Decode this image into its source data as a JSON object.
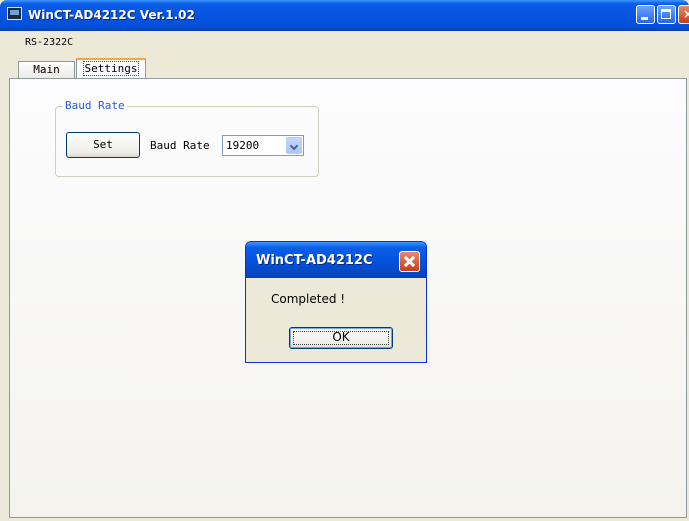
{
  "window": {
    "title": "WinCT-AD4212C Ver.1.02",
    "icon": "app-window-icon",
    "controls": [
      "minimize-icon",
      "maximize-icon",
      "close-icon"
    ]
  },
  "menubar": {
    "item": "RS-2322C"
  },
  "tabs": {
    "main": "Main",
    "settings": "Settings",
    "active": "Settings"
  },
  "baud_group": {
    "title": "Baud Rate",
    "set_button": "Set",
    "label": "Baud Rate",
    "selected_value": "19200"
  },
  "dialog": {
    "title": "WinCT-AD4212C",
    "message": "Completed !",
    "ok_button": "OK"
  },
  "colors": {
    "titlebar": "#0553e0",
    "close_button": "#c83d14",
    "tab_highlight": "#f5a53a",
    "group_title": "#2a5bd7"
  }
}
